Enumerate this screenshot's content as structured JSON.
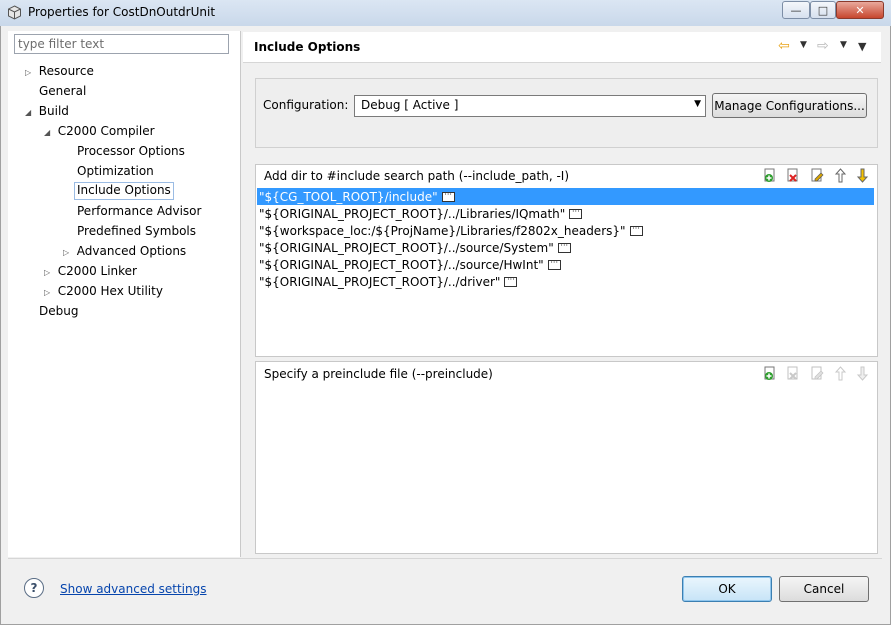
{
  "window": {
    "title": "Properties for CostDnOutdrUnit",
    "controls": {
      "minimize": "—",
      "maximize": "□",
      "close": "✕"
    }
  },
  "filter": {
    "placeholder": "type filter text"
  },
  "tree": {
    "items": [
      {
        "label": "Resource",
        "twisty": "▷"
      },
      {
        "label": "General",
        "twisty": ""
      },
      {
        "label": "Build",
        "twisty": "◢"
      },
      {
        "label": "C2000 Compiler",
        "twisty": "◢"
      },
      {
        "label": "Processor Options",
        "twisty": ""
      },
      {
        "label": "Optimization",
        "twisty": ""
      },
      {
        "label": "Include Options",
        "twisty": ""
      },
      {
        "label": "Performance Advisor",
        "twisty": ""
      },
      {
        "label": "Predefined Symbols",
        "twisty": ""
      },
      {
        "label": "Advanced Options",
        "twisty": "▷"
      },
      {
        "label": "C2000 Linker",
        "twisty": "▷"
      },
      {
        "label": "C2000 Hex Utility",
        "twisty": "▷"
      },
      {
        "label": "Debug",
        "twisty": ""
      }
    ]
  },
  "header": {
    "title": "Include Options",
    "icons": [
      "back-arrow-icon",
      "dropdown-icon",
      "forward-arrow-icon",
      "dropdown-icon",
      "view-menu-icon"
    ]
  },
  "configuration": {
    "label": "Configuration:",
    "selected": "Debug  [ Active ]",
    "manage_button": "Manage Configurations..."
  },
  "include_path": {
    "title": "Add dir to #include search path (--include_path, -I)",
    "entries": [
      "\"${CG_TOOL_ROOT}/include\"",
      "\"${ORIGINAL_PROJECT_ROOT}/../Libraries/IQmath\"",
      "\"${workspace_loc:/${ProjName}/Libraries/f2802x_headers}\"",
      "\"${ORIGINAL_PROJECT_ROOT}/../source/System\"",
      "\"${ORIGINAL_PROJECT_ROOT}/../source/HwInt\"",
      "\"${ORIGINAL_PROJECT_ROOT}/../driver\""
    ]
  },
  "preinclude": {
    "title": "Specify a preinclude file (--preinclude)",
    "entries": []
  },
  "toolbar_icons": [
    "add-icon",
    "delete-icon",
    "edit-icon",
    "move-up-icon",
    "move-down-icon"
  ],
  "footer": {
    "help_glyph": "?",
    "advanced_link": "Show advanced settings",
    "ok": "OK",
    "cancel": "Cancel"
  },
  "colors": {
    "selection": "#3399ff",
    "link": "#0645ad",
    "accent_arrow": "#e8a317"
  }
}
